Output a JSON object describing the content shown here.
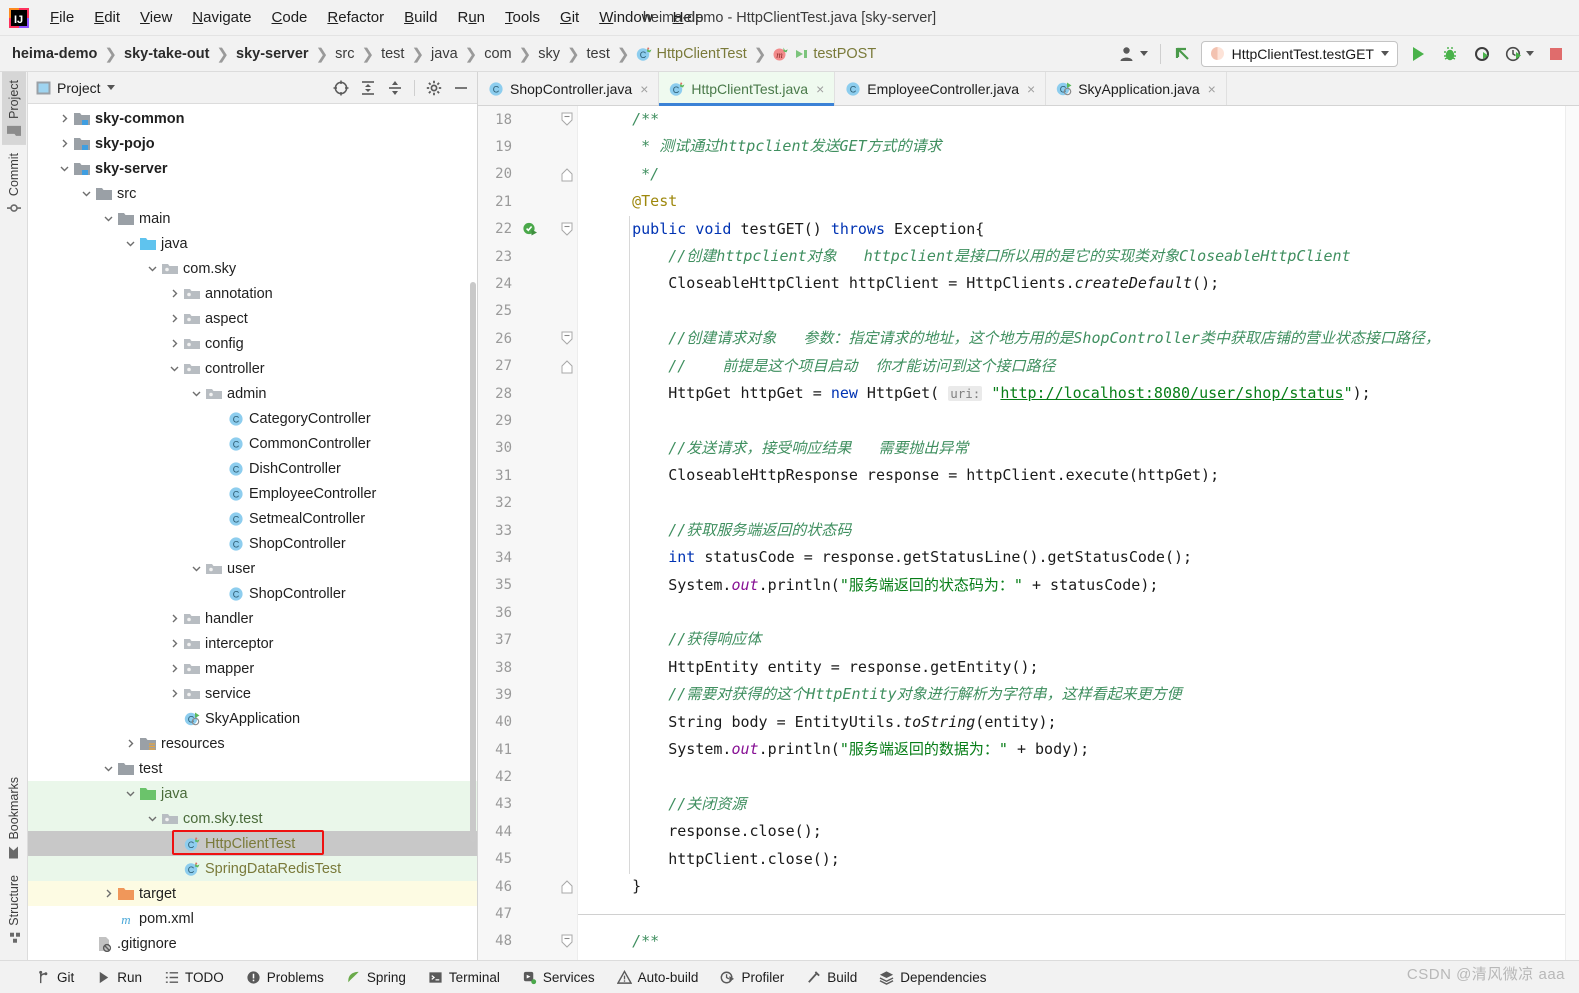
{
  "window": {
    "title": "heima-demo - HttpClientTest.java [sky-server]"
  },
  "menubar": {
    "items": [
      "File",
      "Edit",
      "View",
      "Navigate",
      "Code",
      "Refactor",
      "Build",
      "Run",
      "Tools",
      "Git",
      "Window",
      "Help"
    ]
  },
  "breadcrumb": {
    "items": [
      {
        "label": "heima-demo",
        "style": "bold",
        "icon": ""
      },
      {
        "label": "sky-take-out",
        "style": "bold",
        "icon": ""
      },
      {
        "label": "sky-server",
        "style": "bold",
        "icon": ""
      },
      {
        "label": "src",
        "style": "plain",
        "icon": ""
      },
      {
        "label": "test",
        "style": "plain",
        "icon": ""
      },
      {
        "label": "java",
        "style": "plain",
        "icon": ""
      },
      {
        "label": "com",
        "style": "plain",
        "icon": ""
      },
      {
        "label": "sky",
        "style": "plain",
        "icon": ""
      },
      {
        "label": "test",
        "style": "plain",
        "icon": ""
      },
      {
        "label": "HttpClientTest",
        "style": "class",
        "icon": "test-class-icon"
      },
      {
        "label": "testPOST",
        "style": "class",
        "icon": "test-method-icon"
      }
    ]
  },
  "toolbar": {
    "user_icon": "user-account-icon",
    "updates_icon": "update-project-icon",
    "run_config": "HttpClientTest.testGET",
    "run_icon": "run-icon",
    "debug_icon": "debug-icon",
    "run_coverage_icon": "run-with-coverage-icon",
    "profiler_icon": "profiler-icon",
    "stop_icon": "stop-icon"
  },
  "left_stripe": {
    "top_tabs": [
      {
        "label": "Project",
        "icon": "project-folder-icon",
        "active": true
      },
      {
        "label": "Commit",
        "icon": "commit-icon",
        "active": false
      }
    ],
    "bottom_tabs": [
      {
        "label": "Bookmarks",
        "icon": "bookmark-icon",
        "active": false
      },
      {
        "label": "Structure",
        "icon": "structure-icon",
        "active": false
      }
    ]
  },
  "project_panel": {
    "title": "Project",
    "header_icons": [
      "select-opened-file-icon",
      "expand-all-icon",
      "collapse-all-icon",
      "settings-gear-icon",
      "hide-panel-icon"
    ],
    "tree": [
      {
        "depth": 1,
        "label": "sky-common",
        "arrow": "collapsed",
        "icon": "module-icon",
        "bold": true,
        "bg": "none"
      },
      {
        "depth": 1,
        "label": "sky-pojo",
        "arrow": "collapsed",
        "icon": "module-icon",
        "bold": true,
        "bg": "none"
      },
      {
        "depth": 1,
        "label": "sky-server",
        "arrow": "expanded",
        "icon": "module-icon",
        "bold": true,
        "bg": "none"
      },
      {
        "depth": 2,
        "label": "src",
        "arrow": "expanded",
        "icon": "folder-icon",
        "bold": false,
        "bg": "none"
      },
      {
        "depth": 3,
        "label": "main",
        "arrow": "expanded",
        "icon": "folder-icon",
        "bold": false,
        "bg": "none"
      },
      {
        "depth": 4,
        "label": "java",
        "arrow": "expanded",
        "icon": "source-root-icon",
        "bold": false,
        "bg": "none"
      },
      {
        "depth": 5,
        "label": "com.sky",
        "arrow": "expanded",
        "icon": "package-icon",
        "bold": false,
        "bg": "none"
      },
      {
        "depth": 6,
        "label": "annotation",
        "arrow": "collapsed",
        "icon": "package-icon",
        "bold": false,
        "bg": "none"
      },
      {
        "depth": 6,
        "label": "aspect",
        "arrow": "collapsed",
        "icon": "package-icon",
        "bold": false,
        "bg": "none"
      },
      {
        "depth": 6,
        "label": "config",
        "arrow": "collapsed",
        "icon": "package-icon",
        "bold": false,
        "bg": "none"
      },
      {
        "depth": 6,
        "label": "controller",
        "arrow": "expanded",
        "icon": "package-icon",
        "bold": false,
        "bg": "none"
      },
      {
        "depth": 7,
        "label": "admin",
        "arrow": "expanded",
        "icon": "package-icon",
        "bold": false,
        "bg": "none"
      },
      {
        "depth": 8,
        "label": "CategoryController",
        "arrow": "none",
        "icon": "java-class-icon",
        "bold": false,
        "bg": "none"
      },
      {
        "depth": 8,
        "label": "CommonController",
        "arrow": "none",
        "icon": "java-class-icon",
        "bold": false,
        "bg": "none"
      },
      {
        "depth": 8,
        "label": "DishController",
        "arrow": "none",
        "icon": "java-class-icon",
        "bold": false,
        "bg": "none"
      },
      {
        "depth": 8,
        "label": "EmployeeController",
        "arrow": "none",
        "icon": "java-class-icon",
        "bold": false,
        "bg": "none"
      },
      {
        "depth": 8,
        "label": "SetmealController",
        "arrow": "none",
        "icon": "java-class-icon",
        "bold": false,
        "bg": "none"
      },
      {
        "depth": 8,
        "label": "ShopController",
        "arrow": "none",
        "icon": "java-class-icon",
        "bold": false,
        "bg": "none"
      },
      {
        "depth": 7,
        "label": "user",
        "arrow": "expanded",
        "icon": "package-icon",
        "bold": false,
        "bg": "none"
      },
      {
        "depth": 8,
        "label": "ShopController",
        "arrow": "none",
        "icon": "java-class-icon",
        "bold": false,
        "bg": "none"
      },
      {
        "depth": 6,
        "label": "handler",
        "arrow": "collapsed",
        "icon": "package-icon",
        "bold": false,
        "bg": "none"
      },
      {
        "depth": 6,
        "label": "interceptor",
        "arrow": "collapsed",
        "icon": "package-icon",
        "bold": false,
        "bg": "none"
      },
      {
        "depth": 6,
        "label": "mapper",
        "arrow": "collapsed",
        "icon": "package-icon",
        "bold": false,
        "bg": "none"
      },
      {
        "depth": 6,
        "label": "service",
        "arrow": "collapsed",
        "icon": "package-icon",
        "bold": false,
        "bg": "none"
      },
      {
        "depth": 6,
        "label": "SkyApplication",
        "arrow": "none",
        "icon": "spring-class-icon",
        "bold": false,
        "bg": "none"
      },
      {
        "depth": 4,
        "label": "resources",
        "arrow": "collapsed",
        "icon": "resource-root-icon",
        "bold": false,
        "bg": "none"
      },
      {
        "depth": 3,
        "label": "test",
        "arrow": "expanded",
        "icon": "folder-icon",
        "bold": false,
        "bg": "none"
      },
      {
        "depth": 4,
        "label": "java",
        "arrow": "expanded",
        "icon": "test-source-root-icon",
        "bold": false,
        "bg": "green"
      },
      {
        "depth": 5,
        "label": "com.sky.test",
        "arrow": "expanded",
        "icon": "package-icon",
        "bold": false,
        "bg": "green"
      },
      {
        "depth": 6,
        "label": "HttpClientTest",
        "arrow": "none",
        "icon": "test-class-icon",
        "bold": false,
        "bg": "selected",
        "outlined": true
      },
      {
        "depth": 6,
        "label": "SpringDataRedisTest",
        "arrow": "none",
        "icon": "test-class-icon",
        "bold": false,
        "bg": "green"
      },
      {
        "depth": 3,
        "label": "target",
        "arrow": "collapsed",
        "icon": "excluded-folder-icon",
        "bold": false,
        "bg": "yellow"
      },
      {
        "depth": 3,
        "label": "pom.xml",
        "arrow": "none",
        "icon": "maven-icon",
        "bold": false,
        "bg": "none"
      },
      {
        "depth": 2,
        "label": ".gitignore",
        "arrow": "none",
        "icon": "gitignore-icon",
        "bold": false,
        "bg": "none"
      }
    ]
  },
  "editor_tabs": [
    {
      "label": "ShopController.java",
      "icon": "java-class-icon",
      "active": false
    },
    {
      "label": "HttpClientTest.java",
      "icon": "test-class-icon",
      "active": true
    },
    {
      "label": "EmployeeController.java",
      "icon": "java-class-icon",
      "active": false
    },
    {
      "label": "SkyApplication.java",
      "icon": "spring-class-icon",
      "active": false
    }
  ],
  "editor": {
    "first_line": 18,
    "last_line": 48,
    "gutter_run_icon_line": 22,
    "lines": [
      {
        "n": 18,
        "fold": "start",
        "text": "    /**"
      },
      {
        "n": 19,
        "fold": "",
        "text": "     * 测试通过httpclient发送GET方式的请求"
      },
      {
        "n": 20,
        "fold": "end",
        "text": "     */"
      },
      {
        "n": 21,
        "fold": "",
        "text": "    @Test"
      },
      {
        "n": 22,
        "fold": "start",
        "text": "    public void testGET() throws Exception{"
      },
      {
        "n": 23,
        "fold": "",
        "text": "        //创建httpclient对象   httpclient是接口所以用的是它的实现类对象CloseableHttpClient"
      },
      {
        "n": 24,
        "fold": "",
        "text": "        CloseableHttpClient httpClient = HttpClients.createDefault();"
      },
      {
        "n": 25,
        "fold": "",
        "text": ""
      },
      {
        "n": 26,
        "fold": "start",
        "text": "        //创建请求对象   参数：指定请求的地址，这个地方用的是ShopController类中获取店铺的营业状态接口路径，"
      },
      {
        "n": 27,
        "fold": "end",
        "text": "        //    前提是这个项目启动  你才能访问到这个接口路径"
      },
      {
        "n": 28,
        "fold": "",
        "text": "        HttpGet httpGet = new HttpGet( uri: \"http://localhost:8080/user/shop/status\");"
      },
      {
        "n": 29,
        "fold": "",
        "text": ""
      },
      {
        "n": 30,
        "fold": "",
        "text": "        //发送请求，接受响应结果   需要抛出异常"
      },
      {
        "n": 31,
        "fold": "",
        "text": "        CloseableHttpResponse response = httpClient.execute(httpGet);"
      },
      {
        "n": 32,
        "fold": "",
        "text": ""
      },
      {
        "n": 33,
        "fold": "",
        "text": "        //获取服务端返回的状态码"
      },
      {
        "n": 34,
        "fold": "",
        "text": "        int statusCode = response.getStatusLine().getStatusCode();"
      },
      {
        "n": 35,
        "fold": "",
        "text": "        System.out.println(\"服务端返回的状态码为：\" + statusCode);"
      },
      {
        "n": 36,
        "fold": "",
        "text": ""
      },
      {
        "n": 37,
        "fold": "",
        "text": "        //获得响应体"
      },
      {
        "n": 38,
        "fold": "",
        "text": "        HttpEntity entity = response.getEntity();"
      },
      {
        "n": 39,
        "fold": "",
        "text": "        //需要对获得的这个HttpEntity对象进行解析为字符串，这样看起来更方便"
      },
      {
        "n": 40,
        "fold": "",
        "text": "        String body = EntityUtils.toString(entity);"
      },
      {
        "n": 41,
        "fold": "",
        "text": "        System.out.println(\"服务端返回的数据为：\" + body);"
      },
      {
        "n": 42,
        "fold": "",
        "text": ""
      },
      {
        "n": 43,
        "fold": "",
        "text": "        //关闭资源"
      },
      {
        "n": 44,
        "fold": "",
        "text": "        response.close();"
      },
      {
        "n": 45,
        "fold": "",
        "text": "        httpClient.close();"
      },
      {
        "n": 46,
        "fold": "end",
        "text": "    }"
      },
      {
        "n": 47,
        "fold": "",
        "text": ""
      },
      {
        "n": 48,
        "fold": "start",
        "text": "    /**"
      }
    ]
  },
  "statusbar": {
    "items": [
      {
        "label": "Git",
        "icon": "git-branch-icon"
      },
      {
        "label": "Run",
        "icon": "run-icon"
      },
      {
        "label": "TODO",
        "icon": "todo-icon"
      },
      {
        "label": "Problems",
        "icon": "problems-icon"
      },
      {
        "label": "Spring",
        "icon": "spring-leaf-icon"
      },
      {
        "label": "Terminal",
        "icon": "terminal-icon"
      },
      {
        "label": "Services",
        "icon": "services-icon"
      },
      {
        "label": "Auto-build",
        "icon": "auto-build-icon"
      },
      {
        "label": "Profiler",
        "icon": "profiler-icon"
      },
      {
        "label": "Build",
        "icon": "build-hammer-icon"
      },
      {
        "label": "Dependencies",
        "icon": "dependencies-icon"
      }
    ],
    "watermark": "CSDN @清风微凉 aaa"
  },
  "colors": {
    "accent_blue": "#3b82d6",
    "tab_active_bg": "#effaef",
    "tree_green_bg": "#eaf7ea",
    "tree_yellow_bg": "#fdfbe3",
    "tree_selected_bg": "#c8c8c8",
    "highlight_outline": "#ee1111",
    "comment_green": "#3f8f5f",
    "string_green": "#067d17",
    "keyword_blue": "#0033b3",
    "annotation_yellow": "#9e880d",
    "field_purple": "#871094",
    "run_green": "#49b24a",
    "stop_red": "#e06c6c"
  }
}
